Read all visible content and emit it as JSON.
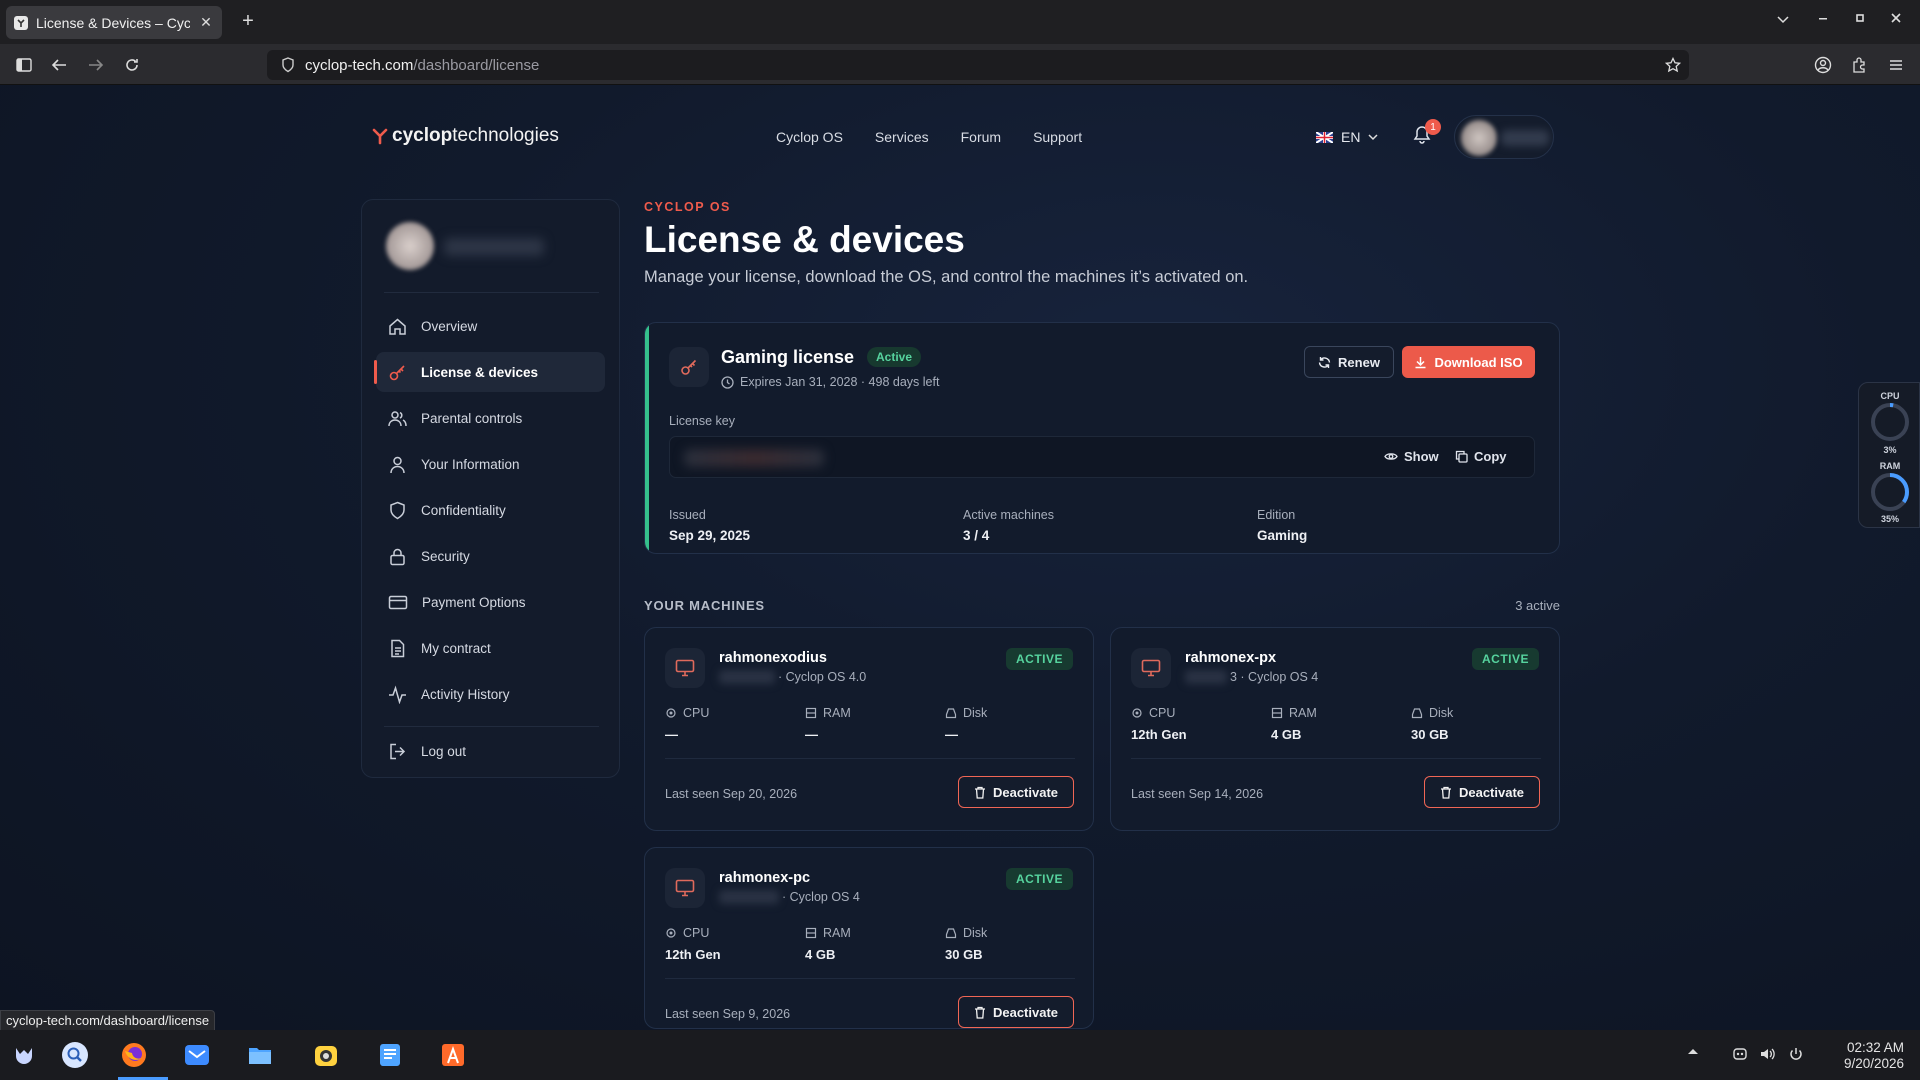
{
  "browser": {
    "tab_title": "License & Devices – Cyclop",
    "new_tab": "+",
    "url_host": "cyclop-tech.com",
    "url_path": "/dashboard/license",
    "status_url": "cyclop-tech.com/dashboard/license"
  },
  "site": {
    "logo_bold": "cyclop",
    "logo_rest": "technologies",
    "nav": [
      "Cyclop OS",
      "Services",
      "Forum",
      "Support"
    ],
    "lang": "EN",
    "notifications": "1"
  },
  "sidebar": {
    "items": [
      {
        "label": "Overview",
        "icon": "home-icon"
      },
      {
        "label": "License & devices",
        "icon": "key-icon",
        "active": true
      },
      {
        "label": "Parental controls",
        "icon": "users-icon"
      },
      {
        "label": "Your Information",
        "icon": "user-icon"
      },
      {
        "label": "Confidentiality",
        "icon": "shield-icon"
      },
      {
        "label": "Security",
        "icon": "lock-icon"
      },
      {
        "label": "Payment Options",
        "icon": "credit-card-icon"
      },
      {
        "label": "My contract",
        "icon": "document-icon"
      },
      {
        "label": "Activity History",
        "icon": "activity-icon"
      }
    ],
    "logout": "Log out"
  },
  "header": {
    "eyebrow": "CYCLOP OS",
    "title": "License & devices",
    "subtitle": "Manage your license, download the OS, and control the machines it’s activated on."
  },
  "license": {
    "title": "Gaming license",
    "status": "Active",
    "expiry": "Expires Jan 31, 2028 · 498 days left",
    "renew": "Renew",
    "download": "Download ISO",
    "key_label": "License key",
    "show": "Show",
    "copy": "Copy",
    "issued_label": "Issued",
    "issued": "Sep 29, 2025",
    "machines_label": "Active machines",
    "machines": "3 / 4",
    "edition_label": "Edition",
    "edition": "Gaming"
  },
  "machines_section": {
    "title": "YOUR MACHINES",
    "count": "3 active",
    "cpu_label": "CPU",
    "ram_label": "RAM",
    "disk_label": "Disk",
    "deactivate": "Deactivate",
    "items": [
      {
        "name": "rahmonexodius",
        "os": "· Cyclop OS 4.0",
        "status": "ACTIVE",
        "cpu": "—",
        "ram": "—",
        "disk": "—",
        "last_seen": "Last seen Sep 20, 2026"
      },
      {
        "name": "rahmonex-px",
        "os": "3 · Cyclop OS 4",
        "status": "ACTIVE",
        "cpu": "12th Gen",
        "ram": "4 GB",
        "disk": "30 GB",
        "last_seen": "Last seen Sep 14, 2026"
      },
      {
        "name": "rahmonex-pc",
        "os": "· Cyclop OS 4",
        "status": "ACTIVE",
        "cpu": "12th Gen",
        "ram": "4 GB",
        "disk": "30 GB",
        "last_seen": "Last seen Sep 9, 2026"
      }
    ]
  },
  "widget": {
    "cpu_label": "CPU",
    "cpu": "3%",
    "cpu_level": 0.03,
    "ram_label": "RAM",
    "ram": "35%",
    "ram_level": 0.35
  },
  "taskbar": {
    "time": "02:32 AM",
    "date": "9/20/2026"
  },
  "colors": {
    "accent": "#ef5b4c",
    "success": "#56d39e",
    "bg": "#111a2c"
  }
}
